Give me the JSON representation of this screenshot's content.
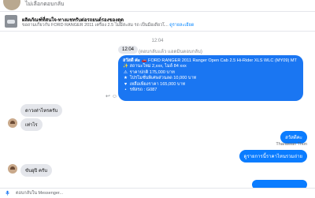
{
  "header": {
    "subtitle": "ไม่เลือกตอบกลับ"
  },
  "pinned": {
    "title": "ผลิตภัณฑ์ที่สนใจ-ทางแชทรับต่อรถยนต์รองของดุด",
    "description": "ขอถามเกี่ยวกับ FORD RANGER 2011 เครื่อง 2.5 ไม่มีสะสม รถ เป็นมือเดียวโ...",
    "link": "ดูรายละเอียด"
  },
  "thread": {
    "time": "12:04",
    "reply_chip": "12:04",
    "reply_ref": "(ตอบกลับแล้ว แอดมินตอบกลับ)",
    "car_details": {
      "line1_label": "สวัสดี ค่ะ",
      "line1": "FORD RANGER 2011 Ranger Open Cab 2.5 Hi-Rider XLS WLC (MY09) MT",
      "line2": "สถานะใหม่ 2,xxx, ไมล์ 84 xxx",
      "line3": "ราคาปกติ 175,000 บาท",
      "line4": "โปรโมชั่นพิเศษส่วนลด 10,000 บาท",
      "line5": "เหลือเพียงราคา 165,000 บาท",
      "line6": "รหัสรถ : G087"
    },
    "icons": {
      "reply": "reply-icon",
      "react": "smile-icon"
    },
    "messages": [
      {
        "text": "ดาวเท่าไหรครับ",
        "side": "left"
      },
      {
        "text": "เท่าไร",
        "side": "left"
      },
      {
        "text": "สวัสดีคะ",
        "side": "right"
      },
      {
        "text": "Thanawan Thon",
        "side": "right-sender"
      },
      {
        "text": "ดูรายการนี้ราคาไหนรวมถ่าย",
        "side": "right"
      },
      {
        "text": "ขับอุปิ ครับ",
        "side": "left"
      }
    ]
  },
  "composer": {
    "placeholder": "ตอบกลับใน Messenger..."
  },
  "colors": {
    "accent": "#1a76f2",
    "incoming": "#e4e6eb"
  }
}
